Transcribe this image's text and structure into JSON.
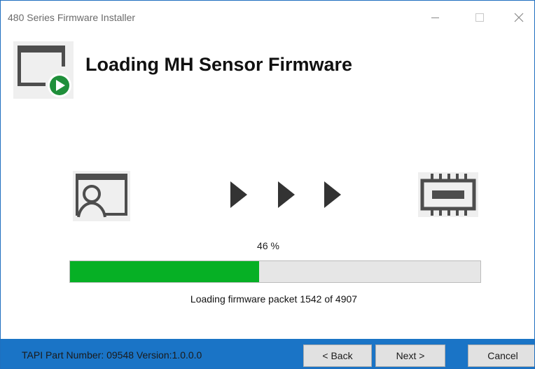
{
  "window": {
    "title": "480 Series Firmware Installer"
  },
  "header": {
    "title": "Loading MH Sensor Firmware",
    "icon": "window-play-icon"
  },
  "flow": {
    "source_icon": "user-window-icon",
    "arrow_icon": "triangle-right-icon",
    "target_icon": "chip-icon",
    "arrow_color": "#333333"
  },
  "progress": {
    "percent_label": "46 %",
    "value": 0.46,
    "fill_color": "#06b025",
    "status": "Loading firmware packet 1542 of 4907"
  },
  "footer": {
    "part_info": "TAPI Part Number: 09548  Version:1.0.0.0",
    "back_label": "< Back",
    "next_label": "Next >",
    "cancel_label": "Cancel",
    "background": "#1a74c6"
  }
}
